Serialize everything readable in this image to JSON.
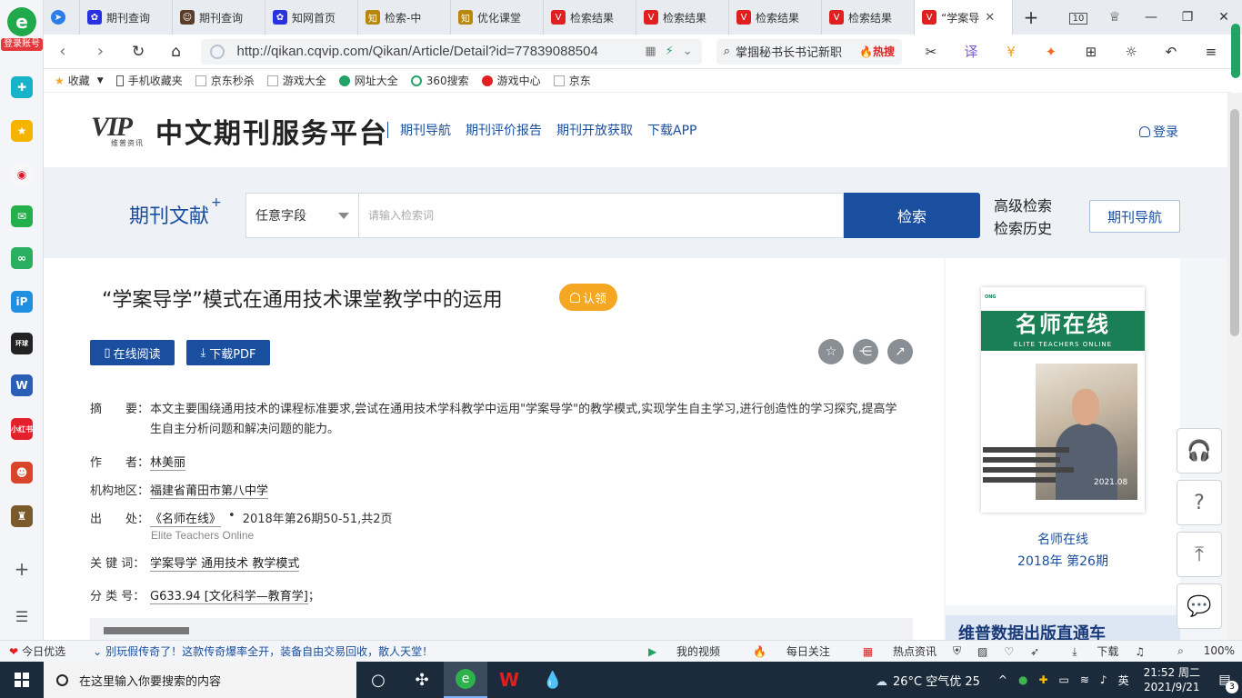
{
  "browser": {
    "tabs": [
      {
        "label": "期刊查询",
        "icon": "baidu-paw-icon",
        "color": "#2932e1"
      },
      {
        "label": "期刊查询",
        "icon": "person-icon",
        "color": "#5a3e2b"
      },
      {
        "label": "知网首页",
        "icon": "baidu-paw-icon",
        "color": "#2932e1"
      },
      {
        "label": "检索-中",
        "icon": "zhi-icon",
        "color": "#b8860b"
      },
      {
        "label": "优化课堂",
        "icon": "zhi-icon",
        "color": "#b8860b"
      },
      {
        "label": "检索结果",
        "icon": "vip-icon",
        "color": "#e02020"
      },
      {
        "label": "检索结果",
        "icon": "vip-icon",
        "color": "#e02020"
      },
      {
        "label": "检索结果",
        "icon": "vip-icon",
        "color": "#e02020"
      },
      {
        "label": "检索结果",
        "icon": "vip-icon",
        "color": "#e02020"
      },
      {
        "label": "“学案导",
        "icon": "vip-icon",
        "color": "#e02020"
      }
    ],
    "tab_count": "10",
    "url": "http://qikan.cqvip.com/Qikan/Article/Detail?id=77839088504",
    "hot_search": "掌掴秘书长书记新职",
    "hot_label": "热搜",
    "sidebar_badge": "登录账号",
    "bookmarks": [
      "收藏",
      "手机收藏夹",
      "京东秒杀",
      "游戏大全",
      "网址大全",
      "360搜索",
      "游戏中心",
      "京东"
    ]
  },
  "site": {
    "logo_text": "VIP",
    "logo_sub": "维普资讯",
    "title": "中文期刊服务平台",
    "nav": [
      "期刊导航",
      "期刊评价报告",
      "期刊开放获取",
      "下载APP"
    ],
    "login": "登录"
  },
  "search": {
    "label": "期刊文献",
    "plus": "+",
    "field": "任意字段",
    "placeholder": "请输入检索词",
    "button": "检索",
    "advanced": "高级检索",
    "history": "检索历史",
    "journal_nav": "期刊导航"
  },
  "article": {
    "title": "“学案导学”模式在通用技术课堂教学中的运用",
    "claim": "认领",
    "read_online": "在线阅读",
    "download_pdf": "下载PDF",
    "abstract_label": "摘　　要：",
    "abstract": "本文主要围绕通用技术的课程标准要求,尝试在通用技术学科教学中运用\"学案导学\"的教学模式,实现学生自主学习,进行创造性的学习探究,提高学生自主分析问题和解决问题的能力。",
    "author_label": "作　　者：",
    "author": "林美丽",
    "org_label": "机构地区：",
    "org": "福建省莆田市第八中学",
    "source_label": "出　　处：",
    "source_journal": "《名师在线》",
    "source_detail": "2018年第26期50-51,共2页",
    "source_en": "Elite Teachers Online",
    "keywords_label": "关 键 词：",
    "keywords": [
      "学案导学",
      "通用技术",
      "教学模式"
    ],
    "class_label": "分 类 号：",
    "class_code": "G633.94 [文化科学—教育学]",
    "class_suffix": "；"
  },
  "cover": {
    "title_cn": "名师在线",
    "title_en": "ELITE TEACHERS ONLINE",
    "date": "2021.08",
    "caption_name": "名师在线",
    "caption_issue": "2018年 第26期"
  },
  "ad_banner": "维普数据出版直通车",
  "statusbar": {
    "left": "今日优选",
    "news": "别玩假传奇了！这款传奇爆率全开，装备自由交易回收，散人天堂！",
    "right": [
      "我的视频",
      "每日关注",
      "热点资讯",
      "下载",
      "100%"
    ]
  },
  "taskbar": {
    "search_placeholder": "在这里输入你要搜索的内容",
    "weather": "26°C 空气优 25",
    "ime": "英",
    "time": "21:52 周二",
    "date": "2021/9/21",
    "notifications": "3"
  }
}
